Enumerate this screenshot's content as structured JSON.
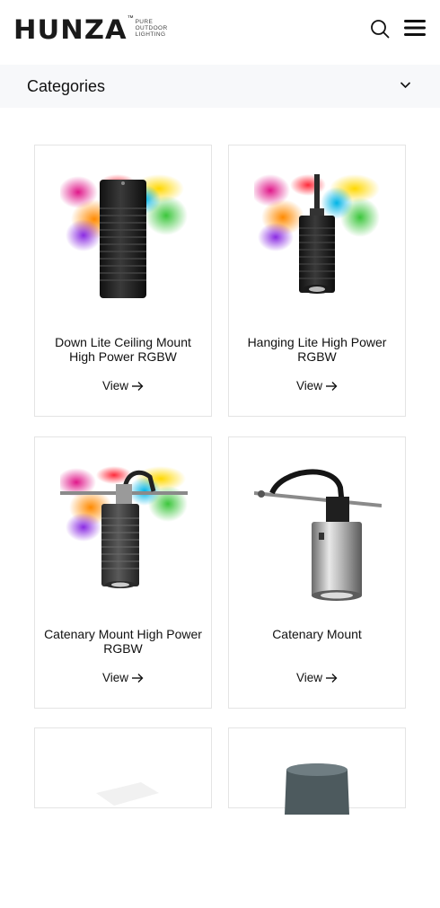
{
  "header": {
    "brand": "HUNZA",
    "trademark": "™",
    "tagline": [
      "PURE",
      "OUTDOOR",
      "LIGHTING"
    ],
    "search_icon": "search-icon",
    "menu_icon": "hamburger-menu-icon"
  },
  "categories": {
    "label": "Categories",
    "icon": "chevron-down-icon"
  },
  "products": [
    {
      "title": "Down Lite Ceiling Mount High Power RGBW",
      "link": "View"
    },
    {
      "title": "Hanging Lite High Power RGBW",
      "link": "View"
    },
    {
      "title": "Catenary Mount High Power RGBW",
      "link": "View"
    },
    {
      "title": "Catenary Mount",
      "link": "View"
    }
  ]
}
